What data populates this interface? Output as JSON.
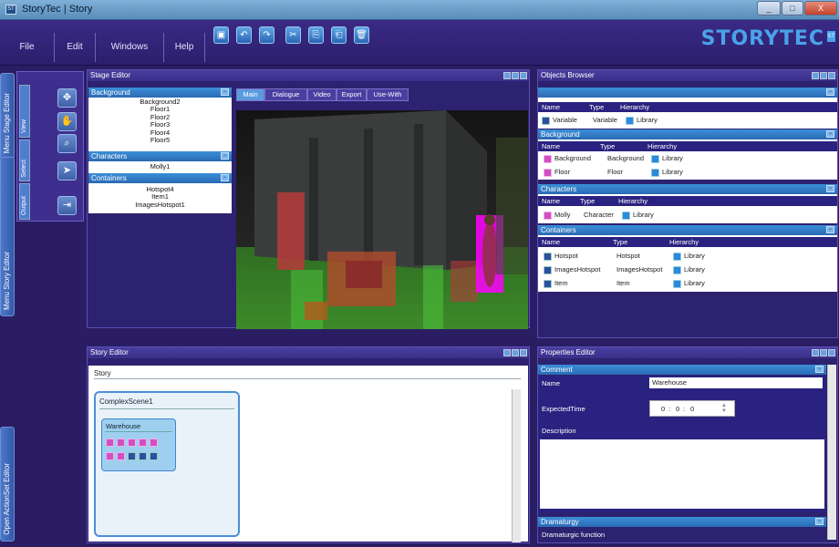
{
  "window": {
    "title": "StoryTec | Story",
    "icon_label": "ST",
    "min": "_",
    "max": "□",
    "close": "X"
  },
  "menu": {
    "items": [
      "File",
      "Edit",
      "Windows",
      "Help"
    ]
  },
  "toolbar": {
    "buttons": [
      "save-icon",
      "undo-icon",
      "redo-icon",
      "cut-icon",
      "copy-icon",
      "paste-icon",
      "delete-icon"
    ],
    "glyphs": [
      "▣",
      "↶",
      "↷",
      "✂",
      "⎘",
      "⎗",
      "🗑"
    ]
  },
  "brand": {
    "logo": "STORYTEC",
    "mark": "ST"
  },
  "left_tabs": {
    "stage": "Menu Stage Editor",
    "story": "Menu Story Editor",
    "actionset": "Open ActionSet Editor"
  },
  "tool_palette": {
    "view": "View",
    "select": "Select",
    "output": "Output"
  },
  "stage_editor": {
    "title": "Stage Editor",
    "background": {
      "label": "Background",
      "items": [
        "Background2",
        "Floor1",
        "Floor2",
        "Floor3",
        "Floor4",
        "Floor5"
      ]
    },
    "characters": {
      "label": "Characters",
      "items": [
        "Molly1"
      ]
    },
    "containers": {
      "label": "Containers",
      "items": [
        "Hotspot4",
        "Item1",
        "ImagesHotspot1"
      ]
    },
    "tabs": [
      "Main",
      "Dialogue",
      "Video",
      "Export",
      "Use-With"
    ]
  },
  "objects_browser": {
    "title": "Objects Browser",
    "columns": [
      "Name",
      "Type",
      "Hierarchy"
    ],
    "top": {
      "rows": [
        {
          "name": "Variable",
          "type": "Variable",
          "hierarchy": "Library"
        }
      ]
    },
    "background": {
      "label": "Background",
      "rows": [
        {
          "name": "Background",
          "type": "Background",
          "hierarchy": "Library"
        },
        {
          "name": "Floor",
          "type": "Floor",
          "hierarchy": "Library"
        }
      ]
    },
    "characters": {
      "label": "Characters",
      "rows": [
        {
          "name": "Molly",
          "type": "Character",
          "hierarchy": "Library"
        }
      ]
    },
    "containers": {
      "label": "Containers",
      "rows": [
        {
          "name": "Hotspot",
          "type": "Hotspot",
          "hierarchy": "Library"
        },
        {
          "name": "ImagesHotspot",
          "type": "ImagesHotspot",
          "hierarchy": "Library"
        },
        {
          "name": "Item",
          "type": "Item",
          "hierarchy": "Library"
        }
      ]
    }
  },
  "story_editor": {
    "title": "Story Editor",
    "story_label": "Story",
    "scene": "ComplexScene1",
    "subscene": "Warehouse"
  },
  "properties_editor": {
    "title": "Properties Editor",
    "comment": "Comment",
    "name_label": "Name",
    "name_value": "Warehouse",
    "expected_label": "ExpectedTime",
    "expected_h": "0",
    "expected_m": "0",
    "expected_s": "0",
    "description_label": "Description",
    "dramaturgy": "Dramaturgy",
    "dramaturgic_function": "Dramaturgic function"
  },
  "colors": {
    "accent": "#3b8fd8",
    "brand": "#4aa3ea",
    "panel_bg": "#2c2270"
  }
}
